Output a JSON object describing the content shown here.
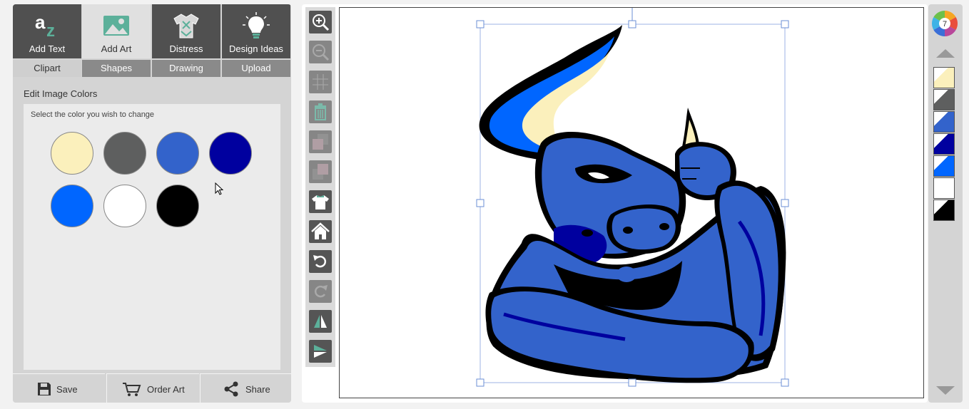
{
  "main_tabs": [
    {
      "label": "Add Text",
      "icon": "add-text-icon"
    },
    {
      "label": "Add Art",
      "icon": "image-icon"
    },
    {
      "label": "Distress",
      "icon": "shirt-icon"
    },
    {
      "label": "Design Ideas",
      "icon": "lightbulb-icon"
    }
  ],
  "sub_tabs": [
    "Clipart",
    "Shapes",
    "Drawing",
    "Upload"
  ],
  "edit_colors": {
    "title": "Edit Image Colors",
    "instruction": "Select the color you wish to change",
    "swatches": [
      "#FBF0BC",
      "#5E5F5F",
      "#3363CB",
      "#00009F",
      "#0066FF",
      "#FFFFFF",
      "#000000"
    ]
  },
  "bottom_actions": {
    "save": "Save",
    "order_art": "Order Art",
    "share": "Share"
  },
  "toolbar": [
    "zoom-in",
    "zoom-out",
    "grid",
    "delete",
    "send-backward",
    "bring-forward",
    "shirt",
    "home",
    "undo",
    "redo",
    "flip-horizontal",
    "flip-vertical"
  ],
  "right_panel": {
    "color_count": "7",
    "layer_colors": [
      "#FBF0BC",
      "#5E5F5F",
      "#3363CB",
      "#00009F",
      "#0066FF",
      "#FFFFFF",
      "#000000"
    ]
  },
  "colors": {
    "tab_dark": "#505050",
    "tab_active": "#E0E0E0",
    "panel_bg": "#D4D4D4",
    "accent_green": "#5CB09A"
  }
}
